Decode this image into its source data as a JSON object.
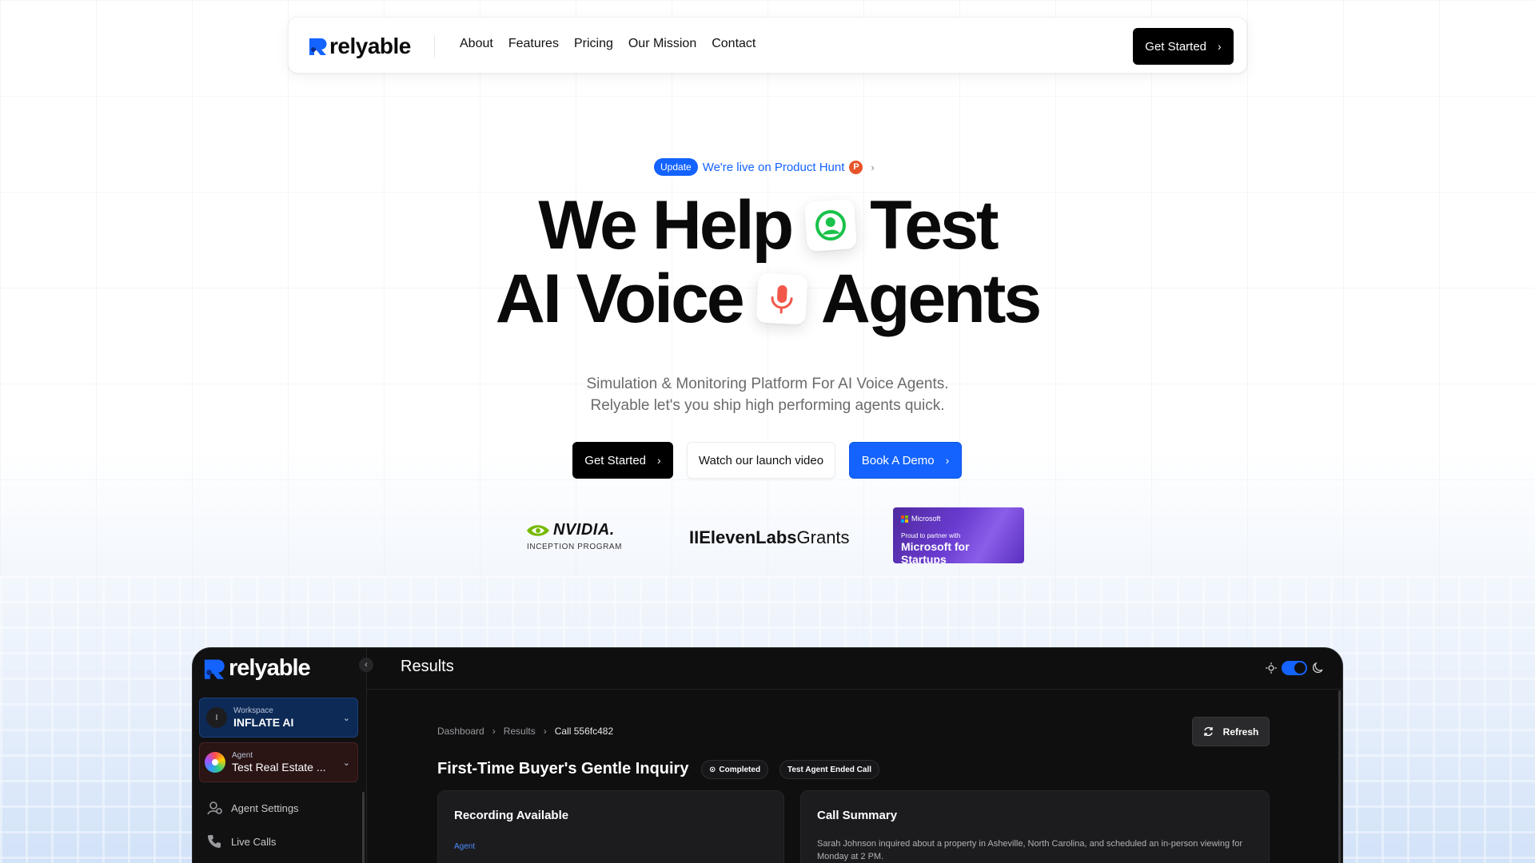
{
  "nav": {
    "logo_text": "relyable",
    "links": [
      "About",
      "Features",
      "Pricing",
      "Our Mission",
      "Contact"
    ],
    "cta_label": "Get Started"
  },
  "badge": {
    "pill": "Update",
    "text": "We're live on Product Hunt",
    "ph_letter": "P"
  },
  "hero": {
    "line1_a": "We Help",
    "line1_b": "Test",
    "line2_a": "AI Voice",
    "line2_b": "Agents",
    "subtitle_1": "Simulation & Monitoring Platform For AI Voice Agents.",
    "subtitle_2": "Relyable let's you ship high performing agents quick."
  },
  "ctas": {
    "get_started": "Get Started",
    "watch": "Watch our launch video",
    "demo": "Book A Demo"
  },
  "partners": {
    "nvidia_name": "NVIDIA.",
    "nvidia_sub": "INCEPTION PROGRAM",
    "eleven_prefix": "II",
    "eleven_bold": "ElevenLabs",
    "eleven_suffix": "Grants",
    "ms_brand": "Microsoft",
    "ms_sub": "Proud to partner with",
    "ms_main": "Microsoft for Startups"
  },
  "dashboard": {
    "logo_text": "relyable",
    "page_title": "Results",
    "workspace": {
      "label": "Workspace",
      "value": "INFLATE AI",
      "avatar": "I"
    },
    "agent": {
      "label": "Agent",
      "value": "Test Real Estate ..."
    },
    "side_items": [
      "Agent Settings",
      "Live Calls"
    ],
    "breadcrumb": [
      "Dashboard",
      "Results",
      "Call 556fc482"
    ],
    "refresh_label": "Refresh",
    "call_title": "First-Time Buyer's Gentle Inquiry",
    "status_chip": "Completed",
    "ended_chip": "Test Agent Ended Call",
    "recording_title": "Recording Available",
    "recording_sub": "Agent",
    "summary_title": "Call Summary",
    "summary_text": "Sarah Johnson inquired about a property in Asheville, North Carolina, and scheduled an in-person viewing for Monday at 2 PM."
  },
  "colors": {
    "accent": "#1463ff",
    "product_hunt": "#e8542a",
    "mic_red": "#f2574a",
    "user_green": "#19c24a",
    "dashboard_bg": "#0f0f10"
  }
}
